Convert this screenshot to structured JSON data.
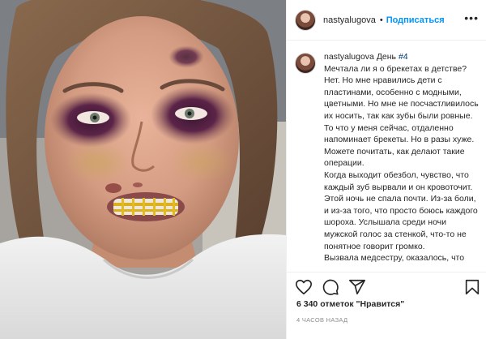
{
  "post": {
    "username": "nastyalugova",
    "separator": "•",
    "follow_label": "Подписаться",
    "more_icon": "more-horizontal-icon"
  },
  "caption": {
    "username": "nastyalugova",
    "day_prefix": "День ",
    "hashtag": "#4",
    "paragraphs": [
      "Мечтала ли я о брекетах в детстве? Нет. Но мне нравились дети с пластинами, особенно с модными, цветными. Но мне не посчастливилось их носить, так как зубы были ровные.",
      "То что у меня сейчас, отдаленно напоминает брекеты. Но в разы хуже. Можете почитать, как делают такие операции.",
      "Когда выходит обезбол, чувство, что каждый зуб вырвали и он кровоточит.",
      "Этой ночь не спала почти. Из-за боли, и из-за того, что просто боюсь каждого шороха. Услышала среди ночи мужской голос за стенкой, что-то не понятное говорит громко.",
      "Вызвала медсестру, оказалось, что"
    ]
  },
  "actions": {
    "like_icon": "heart-icon",
    "comment_icon": "comment-icon",
    "share_icon": "share-icon",
    "save_icon": "bookmark-icon",
    "likes_text": "6 340 отметок \"Нравится\"",
    "time_text": "4 ЧАСОВ НАЗАД"
  },
  "colors": {
    "follow": "#0095f6",
    "hashtag": "#00376b",
    "muted": "#8e8e8e"
  }
}
